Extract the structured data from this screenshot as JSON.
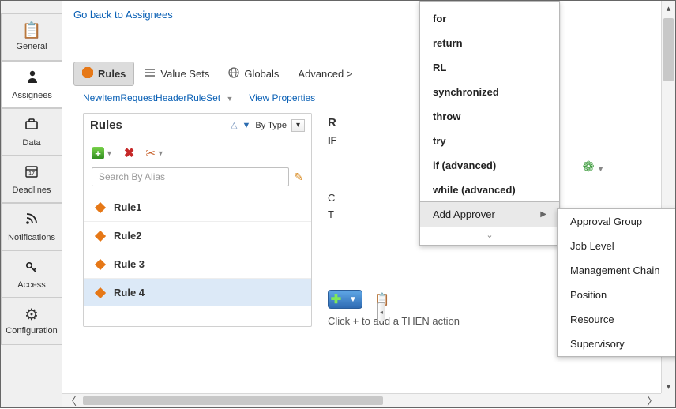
{
  "nav": {
    "goback": "Go back to Assignees",
    "tabs": [
      {
        "id": "general",
        "label": "General",
        "icon": "📋"
      },
      {
        "id": "assignees",
        "label": "Assignees",
        "icon": "👤"
      },
      {
        "id": "data",
        "label": "Data",
        "icon": "💼"
      },
      {
        "id": "deadlines",
        "label": "Deadlines",
        "icon": "📅"
      },
      {
        "id": "notifications",
        "label": "Notifications",
        "icon": "📶"
      },
      {
        "id": "access",
        "label": "Access",
        "icon": "🔑"
      },
      {
        "id": "configuration",
        "label": "Configuration",
        "icon": "⚙"
      }
    ]
  },
  "tabbar": {
    "rules": "Rules",
    "valuesets": "Value Sets",
    "globals": "Globals",
    "advanced": "Advanced >"
  },
  "ruleset": {
    "name": "NewItemRequestHeaderRuleSet",
    "viewprops": "View Properties"
  },
  "rules": {
    "title": "Rules",
    "sortLabel": "By Type",
    "searchPlaceholder": "Search By Alias",
    "items": [
      "Rule1",
      "Rule2",
      "Rule 3",
      "Rule 4"
    ]
  },
  "detail": {
    "titlePrefix": "R",
    "ifPrefix": "IF",
    "hint": "Click + to add a THEN action"
  },
  "ctx": {
    "items": [
      "for",
      "return",
      "RL",
      "synchronized",
      "throw",
      "try",
      "if (advanced)",
      "while (advanced)"
    ],
    "addApprover": "Add Approver",
    "subitems": [
      "Approval Group",
      "Job Level",
      "Management Chain",
      "Position",
      "Resource",
      "Supervisory"
    ]
  },
  "text": {
    "letterC": "C",
    "letterT": "T"
  }
}
